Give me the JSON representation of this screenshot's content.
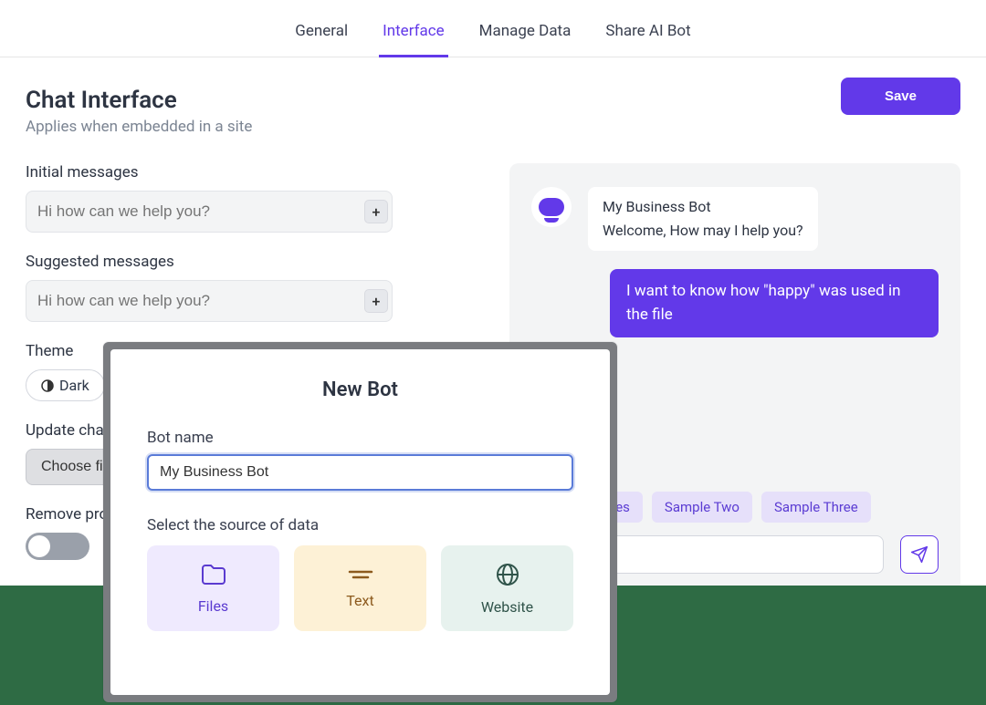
{
  "tabs": {
    "general": "General",
    "interface": "Interface",
    "manage_data": "Manage Data",
    "share": "Share AI Bot"
  },
  "header": {
    "title": "Chat Interface",
    "subtitle": "Applies when embedded in a site",
    "save": "Save"
  },
  "left": {
    "initial_label": "Initial messages",
    "initial_placeholder": "Hi how can we help you?",
    "suggested_label": "Suggested messages",
    "suggested_placeholder": "Hi how can we help you?",
    "theme_label": "Theme",
    "theme_dark": "Dark",
    "update_label": "Update chat",
    "choose_file": "Choose file",
    "remove_label": "Remove prof"
  },
  "preview": {
    "bot_name": "My Business Bot",
    "bot_greeting": "Welcome, How may I help you?",
    "user_msg": "I want to know how \"happy\" was used in the file",
    "chip_trunc": "ted messages",
    "chip2": "Sample Two",
    "chip3": "Sample Three"
  },
  "modal": {
    "title": "New Bot",
    "name_label": "Bot name",
    "name_value": "My Business Bot",
    "source_label": "Select the source of data",
    "files": "Files",
    "text": "Text",
    "website": "Website"
  }
}
